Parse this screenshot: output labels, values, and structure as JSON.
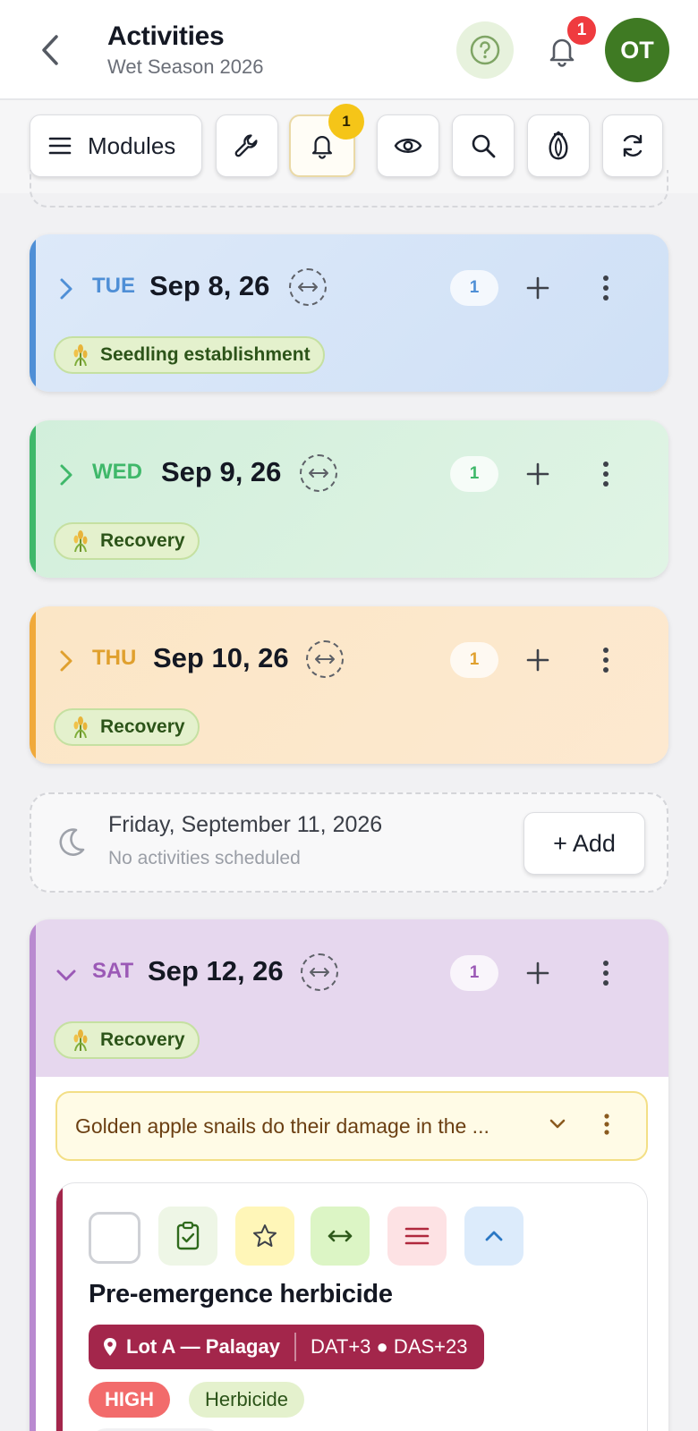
{
  "header": {
    "title": "Activities",
    "subtitle": "Wet Season 2026",
    "notifications_count": "1",
    "avatar_initials": "OT"
  },
  "toolbar": {
    "modules_label": "Modules",
    "alerts_badge": "1",
    "icons": [
      "menu-icon",
      "wrench-icon",
      "bell-icon",
      "eye-icon",
      "search-icon",
      "seed-icon",
      "refresh-icon"
    ]
  },
  "days": [
    {
      "dow": "TUE",
      "date": "Sep 8, 26",
      "count": "1",
      "stage": "Seedling establishment",
      "color": "#4f8fd6",
      "expanded": false
    },
    {
      "dow": "WED",
      "date": "Sep 9, 26",
      "count": "1",
      "stage": "Recovery",
      "color": "#3fb86a",
      "expanded": false
    },
    {
      "dow": "THU",
      "date": "Sep 10, 26",
      "count": "1",
      "stage": "Recovery",
      "color": "#e0a02e",
      "expanded": false
    },
    {
      "dow": "SAT",
      "date": "Sep 12, 26",
      "count": "1",
      "stage": "Recovery",
      "color": "#9b59b6",
      "expanded": true
    }
  ],
  "empty_day": {
    "date": "Friday, September 11, 2026",
    "message": "No activities scheduled",
    "add_label": "+ Add"
  },
  "tip": {
    "text": "Golden apple snails do their damage in the ..."
  },
  "activity": {
    "title": "Pre-emergence herbicide",
    "location": "Lot A — Palagay",
    "timing": "DAT+3 ● DAS+23",
    "priority": "HIGH",
    "category": "Herbicide",
    "accent_color": "#a3264b"
  }
}
